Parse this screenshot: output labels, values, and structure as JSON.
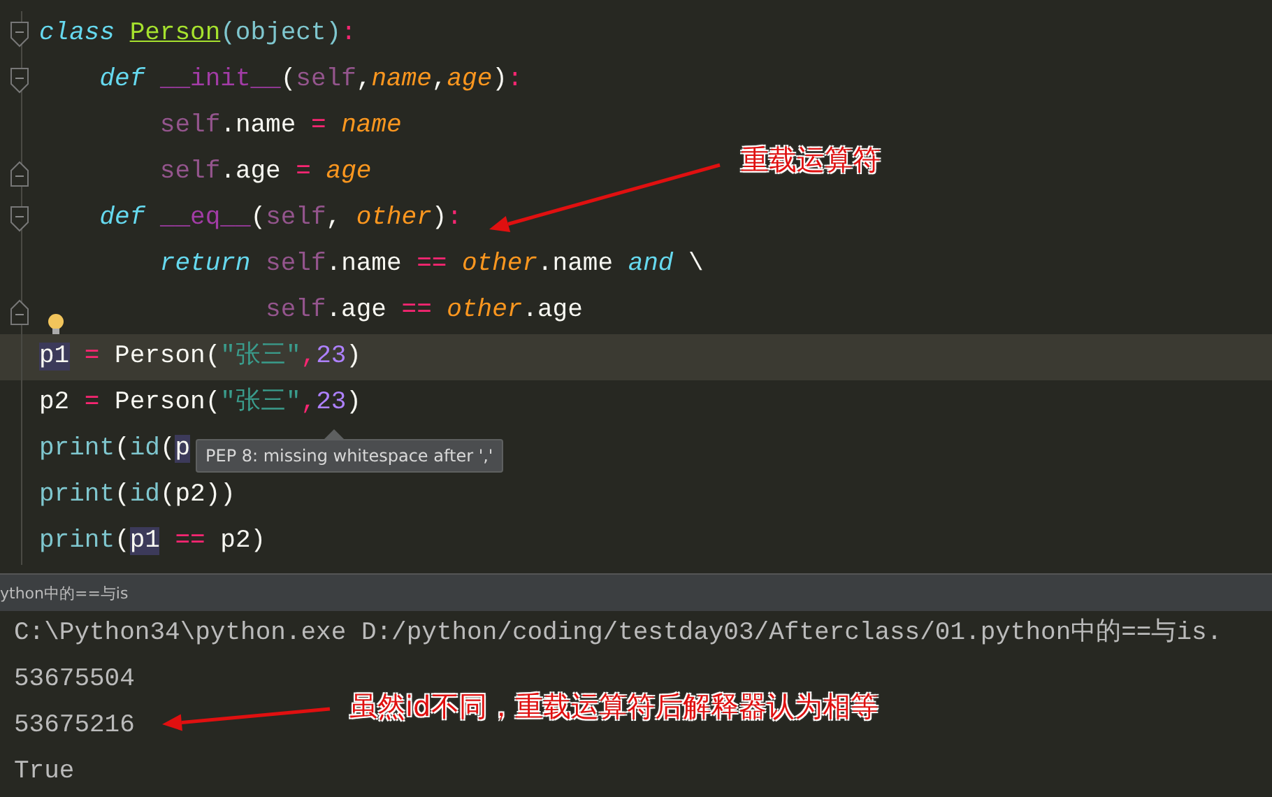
{
  "editor": {
    "lines": [
      {
        "fold": {
          "kind": "start"
        },
        "current": false,
        "tokens": [
          {
            "t": "class ",
            "kind": "keyword"
          },
          {
            "t": "Person",
            "kind": "classname"
          },
          {
            "t": "(object)",
            "kind": "builtin"
          },
          {
            "t": ":",
            "kind": "op"
          }
        ]
      },
      {
        "fold": {
          "kind": "start"
        },
        "current": false,
        "tokens": [
          {
            "t": "    def ",
            "kind": "keyword"
          },
          {
            "t": "__init__",
            "kind": "magic"
          },
          {
            "t": "(",
            "kind": "plain"
          },
          {
            "t": "self",
            "kind": "self"
          },
          {
            "t": ",",
            "kind": "plain"
          },
          {
            "t": "name",
            "kind": "param"
          },
          {
            "t": ",",
            "kind": "plain"
          },
          {
            "t": "age",
            "kind": "param"
          },
          {
            "t": ")",
            "kind": "plain"
          },
          {
            "t": ":",
            "kind": "op"
          }
        ]
      },
      {
        "current": false,
        "tokens": [
          {
            "t": "        self",
            "kind": "self"
          },
          {
            "t": ".name ",
            "kind": "plain"
          },
          {
            "t": "= ",
            "kind": "op"
          },
          {
            "t": "name",
            "kind": "param"
          }
        ]
      },
      {
        "fold": {
          "kind": "end"
        },
        "current": false,
        "tokens": [
          {
            "t": "        self",
            "kind": "self"
          },
          {
            "t": ".age ",
            "kind": "plain"
          },
          {
            "t": "= ",
            "kind": "op"
          },
          {
            "t": "age",
            "kind": "param"
          }
        ]
      },
      {
        "fold": {
          "kind": "start"
        },
        "current": false,
        "tokens": [
          {
            "t": "    def ",
            "kind": "keyword"
          },
          {
            "t": "__eq__",
            "kind": "magic"
          },
          {
            "t": "(",
            "kind": "plain"
          },
          {
            "t": "self",
            "kind": "self"
          },
          {
            "t": ", ",
            "kind": "plain"
          },
          {
            "t": "other",
            "kind": "param"
          },
          {
            "t": ")",
            "kind": "plain"
          },
          {
            "t": ":",
            "kind": "op"
          }
        ]
      },
      {
        "current": false,
        "tokens": [
          {
            "t": "        return ",
            "kind": "keyword"
          },
          {
            "t": "self",
            "kind": "self"
          },
          {
            "t": ".name ",
            "kind": "plain"
          },
          {
            "t": "== ",
            "kind": "op"
          },
          {
            "t": "other",
            "kind": "param"
          },
          {
            "t": ".name ",
            "kind": "plain"
          },
          {
            "t": "and",
            "kind": "keyword"
          },
          {
            "t": " \\",
            "kind": "plain"
          }
        ]
      },
      {
        "fold": {
          "kind": "end"
        },
        "current": false,
        "bulb": true,
        "tokens": [
          {
            "t": "               self",
            "kind": "self"
          },
          {
            "t": ".age ",
            "kind": "plain"
          },
          {
            "t": "== ",
            "kind": "op"
          },
          {
            "t": "other",
            "kind": "param"
          },
          {
            "t": ".age",
            "kind": "plain"
          }
        ]
      },
      {
        "current": true,
        "tokens": [
          {
            "t": "p1",
            "kind": "plain",
            "highlight": true
          },
          {
            "t": " = ",
            "kind": "op"
          },
          {
            "t": "Person(",
            "kind": "plain"
          },
          {
            "t": "\"张三\"",
            "kind": "string"
          },
          {
            "t": ",",
            "kind": "op"
          },
          {
            "t": "23",
            "kind": "number"
          },
          {
            "t": ")",
            "kind": "plain"
          }
        ]
      },
      {
        "current": false,
        "tokens": [
          {
            "t": "p2 ",
            "kind": "plain"
          },
          {
            "t": "= ",
            "kind": "op"
          },
          {
            "t": "Person(",
            "kind": "plain"
          },
          {
            "t": "\"张三\"",
            "kind": "string"
          },
          {
            "t": ",",
            "kind": "op"
          },
          {
            "t": "23",
            "kind": "number"
          },
          {
            "t": ")",
            "kind": "plain"
          }
        ]
      },
      {
        "current": false,
        "tokens": [
          {
            "t": "print",
            "kind": "builtin"
          },
          {
            "t": "(",
            "kind": "plain"
          },
          {
            "t": "id",
            "kind": "builtin"
          },
          {
            "t": "(",
            "kind": "plain"
          },
          {
            "t": "p",
            "kind": "plain",
            "highlight": true
          }
        ]
      },
      {
        "current": false,
        "tokens": [
          {
            "t": "print",
            "kind": "builtin"
          },
          {
            "t": "(",
            "kind": "plain"
          },
          {
            "t": "id",
            "kind": "builtin"
          },
          {
            "t": "(p2))",
            "kind": "plain"
          }
        ]
      },
      {
        "current": false,
        "tokens": [
          {
            "t": "print",
            "kind": "builtin"
          },
          {
            "t": "(",
            "kind": "plain"
          },
          {
            "t": "p1",
            "kind": "plain",
            "highlight": true
          },
          {
            "t": " == ",
            "kind": "op"
          },
          {
            "t": "p2)",
            "kind": "plain"
          }
        ]
      }
    ],
    "tooltip": "PEP 8: missing whitespace after ','"
  },
  "run_panel": {
    "tab_title": "ython中的==与is",
    "output": [
      "C:\\Python34\\python.exe D:/python/coding/testday03/Afterclass/01.python中的==与is.",
      "53675504",
      "53675216",
      "True"
    ]
  },
  "annotations": [
    {
      "text": "重载运算符"
    },
    {
      "text": "虽然id不同，重载运算符后解释器认为相等"
    }
  ]
}
